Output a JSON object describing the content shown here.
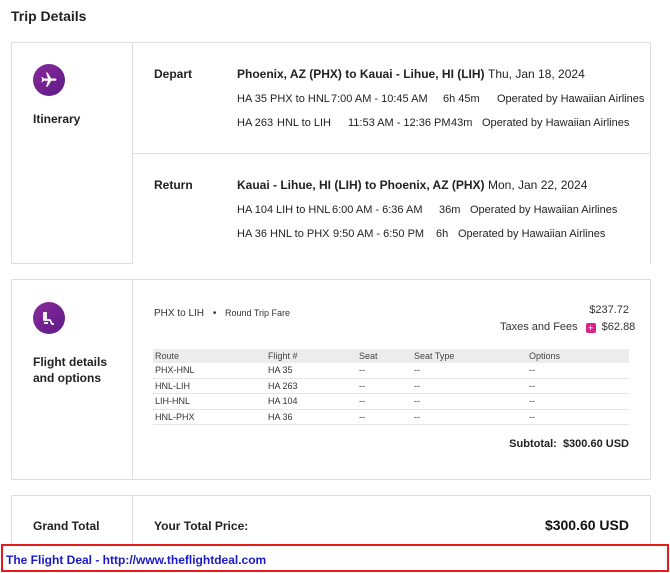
{
  "page_title": "Trip Details",
  "itinerary": {
    "section_label": "Itinerary",
    "icon": "airplane-icon",
    "legs": [
      {
        "label": "Depart",
        "route": "Phoenix, AZ (PHX) to Kauai - Lihue, HI (LIH)",
        "date": "Thu, Jan 18, 2024",
        "segments": [
          {
            "flight": "HA 35",
            "route": "PHX to HNL",
            "time": "7:00 AM - 10:45 AM",
            "duration": "6h 45m",
            "operator": "Operated by Hawaiian Airlines"
          },
          {
            "flight": "HA 263",
            "route": "HNL to LIH",
            "time": "11:53 AM - 12:36 PM",
            "duration": "43m",
            "operator": "Operated by Hawaiian Airlines"
          }
        ]
      },
      {
        "label": "Return",
        "route": "Kauai - Lihue, HI (LIH) to Phoenix, AZ (PHX)",
        "date": "Mon, Jan 22, 2024",
        "segments": [
          {
            "flight": "HA 104",
            "route": "LIH to HNL",
            "time": "6:00 AM - 6:36 AM",
            "duration": "36m",
            "operator": "Operated by Hawaiian Airlines"
          },
          {
            "flight": "HA 36",
            "route": "HNL to PHX",
            "time": "9:50 AM - 6:50 PM",
            "duration": "6h",
            "operator": "Operated by Hawaiian Airlines"
          }
        ]
      }
    ]
  },
  "flight_details": {
    "section_label_line1": "Flight details",
    "section_label_line2": "and options",
    "icon": "seat-icon",
    "route": "PHX to LIH",
    "bullet": "•",
    "fare_type": "Round Trip Fare",
    "fare_price": "$237.72",
    "taxes_label": "Taxes and Fees",
    "taxes_icon": "+",
    "taxes_price": "$62.88",
    "columns": [
      "Route",
      "Flight #",
      "Seat",
      "Seat Type",
      "Options"
    ],
    "rows": [
      [
        "PHX-HNL",
        "HA 35",
        "--",
        "--",
        "--"
      ],
      [
        "HNL-LIH",
        "HA 263",
        "--",
        "--",
        "--"
      ],
      [
        "LIH-HNL",
        "HA 104",
        "--",
        "--",
        "--"
      ],
      [
        "HNL-PHX",
        "HA 36",
        "--",
        "--",
        "--"
      ]
    ],
    "subtotal": "Subtotal:  $300.60 USD"
  },
  "grand_total": {
    "section_label": "Grand Total",
    "your_total_label": "Your Total Price:",
    "amount": "$300.60 USD"
  },
  "banner": {
    "text": "The Flight Deal - http://www.theflightdeal.com"
  },
  "colors": {
    "icon_gradient": "#7a2395",
    "banner_border": "#e21b1b",
    "banner_link": "#1a1acd",
    "plus_badge": "#d6248c"
  }
}
